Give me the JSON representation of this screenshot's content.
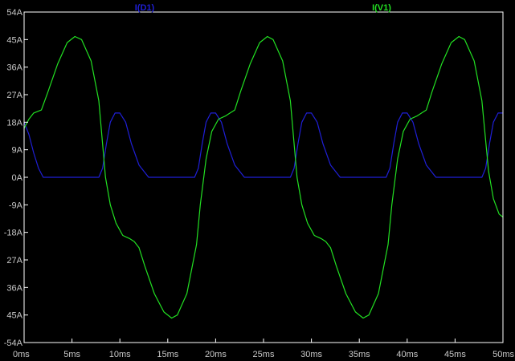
{
  "chart_data": {
    "type": "line",
    "background": "#000000",
    "axis_color": "#ffffff",
    "grid": false,
    "xlim": [
      0,
      50
    ],
    "ylim": [
      -54,
      54
    ],
    "x_ticks": [
      0,
      5,
      10,
      15,
      20,
      25,
      30,
      35,
      40,
      45,
      50
    ],
    "x_tick_labels": [
      "0ms",
      "5ms",
      "10ms",
      "15ms",
      "20ms",
      "25ms",
      "30ms",
      "35ms",
      "40ms",
      "45ms",
      "50ms"
    ],
    "y_ticks": [
      54,
      45,
      36,
      27,
      18,
      9,
      0,
      -9,
      -18,
      -27,
      -36,
      -45,
      -54
    ],
    "y_tick_labels": [
      "54A",
      "45A",
      "36A",
      "27A",
      "18A",
      "9A",
      "0A",
      "-9A",
      "-18A",
      "27A",
      "36A",
      "45A",
      "-54A"
    ],
    "series": [
      {
        "name": "I(D1)",
        "color": "#1f1fd6",
        "x": [
          0,
          0.5,
          1,
          1.5,
          2,
          3,
          4,
          5,
          6,
          7,
          7.8,
          8.2,
          8.6,
          9,
          9.5,
          10,
          10.6,
          11.2,
          12,
          13,
          15,
          17,
          17.8,
          18.2,
          18.6,
          19,
          19.5,
          20,
          20.6,
          21.2,
          22,
          23,
          25,
          27,
          27.8,
          28.2,
          28.6,
          29,
          29.5,
          30,
          30.6,
          31.2,
          32,
          33,
          35,
          37,
          37.8,
          38.2,
          38.6,
          39,
          39.5,
          40,
          40.6,
          41.2,
          42,
          43,
          45,
          47,
          47.8,
          48.2,
          48.6,
          49,
          49.5,
          50
        ],
        "values": [
          18,
          14,
          8,
          3,
          0,
          0,
          0,
          0,
          0,
          0,
          0,
          3,
          11,
          18,
          21,
          21,
          18,
          11,
          4,
          0,
          0,
          0,
          0,
          3,
          11,
          18,
          21,
          21,
          18,
          11,
          4,
          0,
          0,
          0,
          0,
          3,
          11,
          18,
          21,
          21,
          18,
          11,
          4,
          0,
          0,
          0,
          0,
          3,
          11,
          18,
          21,
          21,
          18,
          11,
          4,
          0,
          0,
          0,
          0,
          3,
          11,
          18,
          21,
          21
        ]
      },
      {
        "name": "I(V1)",
        "color": "#22e022",
        "x": [
          0,
          0.5,
          1,
          1.8,
          2.5,
          3.5,
          4.5,
          5.3,
          6,
          7,
          7.8,
          8.5,
          9,
          9.6,
          10.3,
          11,
          11.5,
          12,
          12.6,
          13.6,
          14.6,
          15.4,
          16,
          17,
          18,
          18.4,
          19,
          19.6,
          20.3,
          21,
          21.5,
          22,
          22.6,
          23.6,
          24.6,
          25.4,
          26,
          27,
          27.8,
          28.5,
          29,
          29.6,
          30.3,
          31,
          31.5,
          32,
          32.6,
          33.6,
          34.6,
          35.4,
          36,
          37,
          38,
          38.4,
          39,
          39.6,
          40.3,
          41,
          41.5,
          42,
          42.6,
          43.6,
          44.6,
          45.4,
          46,
          47,
          47.8,
          48.5,
          49,
          49.6,
          50
        ],
        "values": [
          16,
          19,
          21,
          22,
          28,
          37,
          44,
          46,
          45,
          38,
          25,
          0,
          -9,
          -15,
          -19,
          -20,
          -21,
          -23,
          -29,
          -38,
          -44,
          -46,
          -45,
          -38,
          -22,
          -9,
          6,
          15,
          19,
          20,
          21,
          22,
          28,
          37,
          44,
          46,
          45,
          38,
          25,
          0,
          -9,
          -15,
          -19,
          -20,
          -21,
          -23,
          -29,
          -38,
          -44,
          -46,
          -45,
          -38,
          -22,
          -9,
          6,
          15,
          19,
          20,
          21,
          22,
          28,
          37,
          44,
          46,
          45,
          38,
          25,
          2,
          -7,
          -12,
          -13
        ]
      }
    ]
  }
}
